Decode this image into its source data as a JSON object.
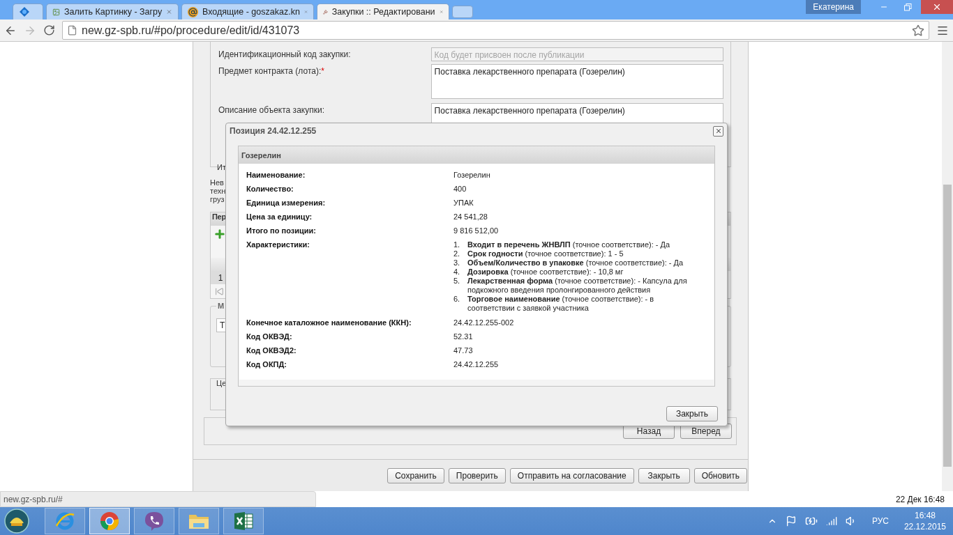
{
  "browser": {
    "tabs": [
      {
        "kind": "pinned",
        "selected": false
      },
      {
        "kind": "image",
        "title": "Залить Картинку - Загру",
        "selected": false
      },
      {
        "kind": "mail",
        "title": "Входящие - goszakaz.kn",
        "selected": false
      },
      {
        "kind": "gavel",
        "title": "Закупки :: Редактировани",
        "selected": true
      }
    ],
    "user": "Екатерина",
    "address": "new.gz-spb.ru/#po/procedure/edit/id/431073",
    "status_url": "new.gz-spb.ru/#"
  },
  "form": {
    "fields": [
      {
        "label": "Идентификационный код закупки:",
        "placeholder": "Код будет присвоен после публикации",
        "kind": "line",
        "disabled": true
      },
      {
        "label": "Предмет контракта (лота):",
        "mark": "*",
        "value": "Поставка лекарственного препарата (Гозерелин)",
        "kind": "area",
        "disabled": false
      },
      {
        "label": "Описание объекта закупки:",
        "value": "Поставка лекарственного препарата (Гозерелин)",
        "kind": "area",
        "disabled": false
      }
    ],
    "cut_label": "Ит"
  },
  "notice_lines": [
    "Нев",
    "техн",
    "груз"
  ],
  "grid": {
    "header": "Пер",
    "row_number": "1"
  },
  "fieldset": {
    "legend": "М",
    "field": "Т"
  },
  "total_box": {
    "label": "Це"
  },
  "nav_buttons": [
    "Назад",
    "Вперед"
  ],
  "footer_buttons": [
    "Сохранить",
    "Проверить",
    "Отправить на согласование",
    "Закрыть",
    "Обновить"
  ],
  "dialog": {
    "title": "Позиция 24.42.12.255",
    "panel_title": "Гозерелин",
    "rows": [
      {
        "kind": "text",
        "label": "Наименование:",
        "value": "Гозерелин"
      },
      {
        "kind": "text",
        "label": "Количество:",
        "value": "400"
      },
      {
        "kind": "text",
        "label": "Единица измерения:",
        "value": "УПАК"
      },
      {
        "kind": "text",
        "label": "Цена за единицу:",
        "value": "24 541,28"
      },
      {
        "kind": "text",
        "label": "Итого по позиции:",
        "value": "9 816 512,00"
      },
      {
        "kind": "list",
        "label": "Характеристики:",
        "items": [
          {
            "number": "1.",
            "text": "**Входит в перечень ЖНВЛП** (точное соответствие): - Да"
          },
          {
            "number": "2.",
            "text": "**Срок годности** (точное соответствие): 1 - 5"
          },
          {
            "number": "3.",
            "text": "**Объем/Количество в упаковке** (точное соответствие): - Да"
          },
          {
            "number": "4.",
            "text": "**Дозировка** (точное соответствие): - 10,8 мг"
          },
          {
            "number": "5.",
            "text": "**Лекарственная форма** (точное соответствие): - Капсула для подкожного введения пролонгированного действия"
          },
          {
            "number": "6.",
            "text": "**Торговое наименование** (точное соответствие): - в соответствии с заявкой участника"
          }
        ]
      },
      {
        "kind": "text",
        "label": "Конечное каталожное наименование (ККН):",
        "value": "24.42.12.255-002"
      },
      {
        "kind": "text",
        "label": "Код ОКВЭД:",
        "value": "52.31"
      },
      {
        "kind": "text",
        "label": "Код ОКВЭД2:",
        "value": "47.73"
      },
      {
        "kind": "text",
        "label": "Код ОКПД:",
        "value": "24.42.12.255"
      }
    ],
    "button": "Закрыть"
  },
  "page_clock": "22 Дек 16:48",
  "taskbar": {
    "apps": [
      {
        "kind": "ie",
        "selected": false
      },
      {
        "kind": "chrome",
        "selected": true
      },
      {
        "kind": "viber",
        "selected": false
      },
      {
        "kind": "explorer",
        "selected": false
      },
      {
        "kind": "excel",
        "selected": false
      }
    ],
    "tray": {
      "language": "РУС",
      "time": "16:48",
      "date": "22.12.2015"
    }
  }
}
